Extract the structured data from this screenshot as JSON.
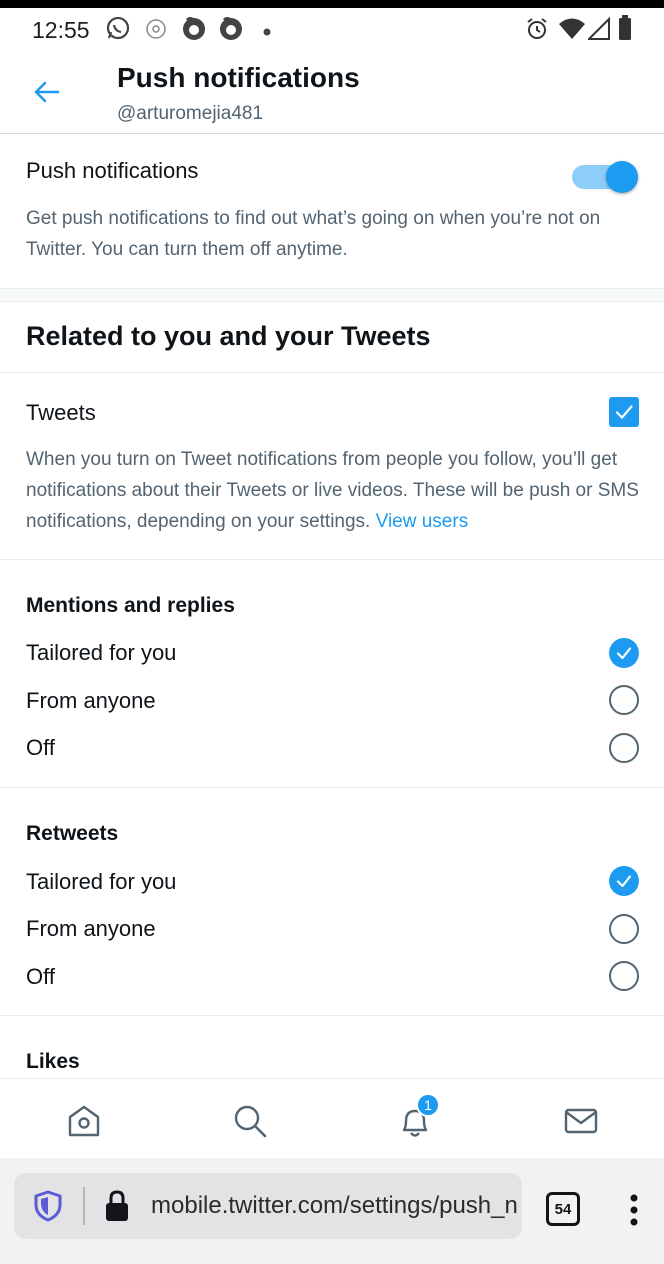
{
  "status_bar": {
    "time": "12:55"
  },
  "header": {
    "title": "Push notifications",
    "handle": "@arturomejia481"
  },
  "push": {
    "label": "Push notifications",
    "enabled": true,
    "description": "Get push notifications to find out what’s going on when you’re not on Twitter. You can turn them off anytime."
  },
  "section": {
    "title": "Related to you and your Tweets"
  },
  "tweets": {
    "label": "Tweets",
    "checked": true,
    "description": "When you turn on Tweet notifications from people you follow, you’ll get notifications about their Tweets or live videos. These will be push or SMS notifications, depending on your settings. ",
    "link": "View users"
  },
  "mentions": {
    "title": "Mentions and replies",
    "options": [
      "Tailored for you",
      "From anyone",
      "Off"
    ],
    "selected": "Tailored for you"
  },
  "retweets": {
    "title": "Retweets",
    "options": [
      "Tailored for you",
      "From anyone",
      "Off"
    ],
    "selected": "Tailored for you"
  },
  "likes": {
    "title": "Likes"
  },
  "bottom_nav": {
    "items": [
      "home-icon",
      "search-icon",
      "notifications-icon",
      "messages-icon"
    ],
    "notification_badge": "1"
  },
  "browser": {
    "url": "mobile.twitter.com/settings/push_notifications",
    "tab_count": "54"
  },
  "colors": {
    "accent": "#1d9bf0",
    "text": "#0f1419",
    "secondary": "#536471"
  }
}
